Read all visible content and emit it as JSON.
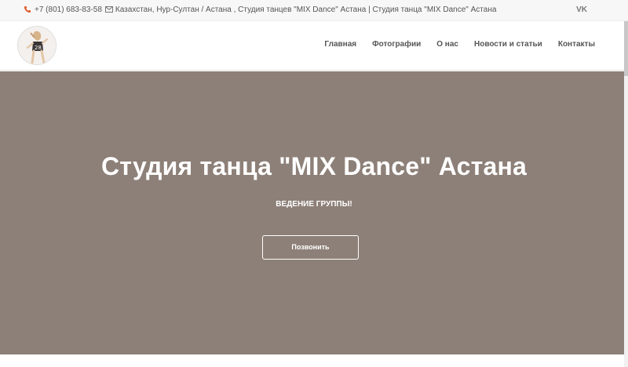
{
  "topbar": {
    "phone": "+7 (801) 683-83-58",
    "address": "Казахстан, Нур-Султан / Астана , Студия танцев \"MIX Dance\" Астана | Студия танца \"MIX Dance\" Астана",
    "social_link": "VK",
    "accent_color": "#e05a2b"
  },
  "header": {
    "nav": [
      {
        "label": "Главная"
      },
      {
        "label": "Фотографии"
      },
      {
        "label": "О нас"
      },
      {
        "label": "Новости и статьи"
      },
      {
        "label": "Контакты"
      }
    ]
  },
  "hero": {
    "title": "Студия танца \"MIX Dance\" Астана",
    "subtitle": "ВЕДЕНИЕ ГРУППЫ!",
    "cta_label": "Позвонить",
    "background_color": "#8d8078"
  }
}
